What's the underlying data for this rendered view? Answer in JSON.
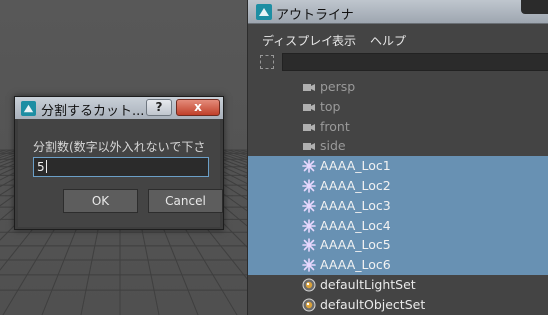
{
  "outliner": {
    "title": "アウトライナ",
    "menu": [
      "ディスプレイ",
      "表示",
      "ヘルプ"
    ],
    "filter_value": "",
    "items": [
      {
        "label": "persp",
        "kind": "camera",
        "selected": false,
        "icon": "camera-icon"
      },
      {
        "label": "top",
        "kind": "camera",
        "selected": false,
        "icon": "camera-icon"
      },
      {
        "label": "front",
        "kind": "camera",
        "selected": false,
        "icon": "camera-icon"
      },
      {
        "label": "side",
        "kind": "camera",
        "selected": false,
        "icon": "camera-icon"
      },
      {
        "label": "AAAA_Loc1",
        "kind": "locator",
        "selected": true,
        "icon": "locator-icon"
      },
      {
        "label": "AAAA_Loc2",
        "kind": "locator",
        "selected": true,
        "icon": "locator-icon"
      },
      {
        "label": "AAAA_Loc3",
        "kind": "locator",
        "selected": true,
        "icon": "locator-icon"
      },
      {
        "label": "AAAA_Loc4",
        "kind": "locator",
        "selected": true,
        "icon": "locator-icon"
      },
      {
        "label": "AAAA_Loc5",
        "kind": "locator",
        "selected": true,
        "icon": "locator-icon"
      },
      {
        "label": "AAAA_Loc6",
        "kind": "locator",
        "selected": true,
        "icon": "locator-icon"
      },
      {
        "label": "defaultLightSet",
        "kind": "set",
        "selected": false,
        "icon": "set-icon"
      },
      {
        "label": "defaultObjectSet",
        "kind": "set",
        "selected": false,
        "icon": "set-icon"
      }
    ]
  },
  "dialog": {
    "title": "分割するカット...",
    "help_label": "?",
    "close_label": "x",
    "prompt": "分割数(数字以外入れないで下さい)",
    "value": "5",
    "ok_label": "OK",
    "cancel_label": "Cancel"
  },
  "colors": {
    "selection": "#6891b3",
    "panel": "#444444",
    "titlebar": "#a9b1bb",
    "close_button": "#c0402a"
  }
}
